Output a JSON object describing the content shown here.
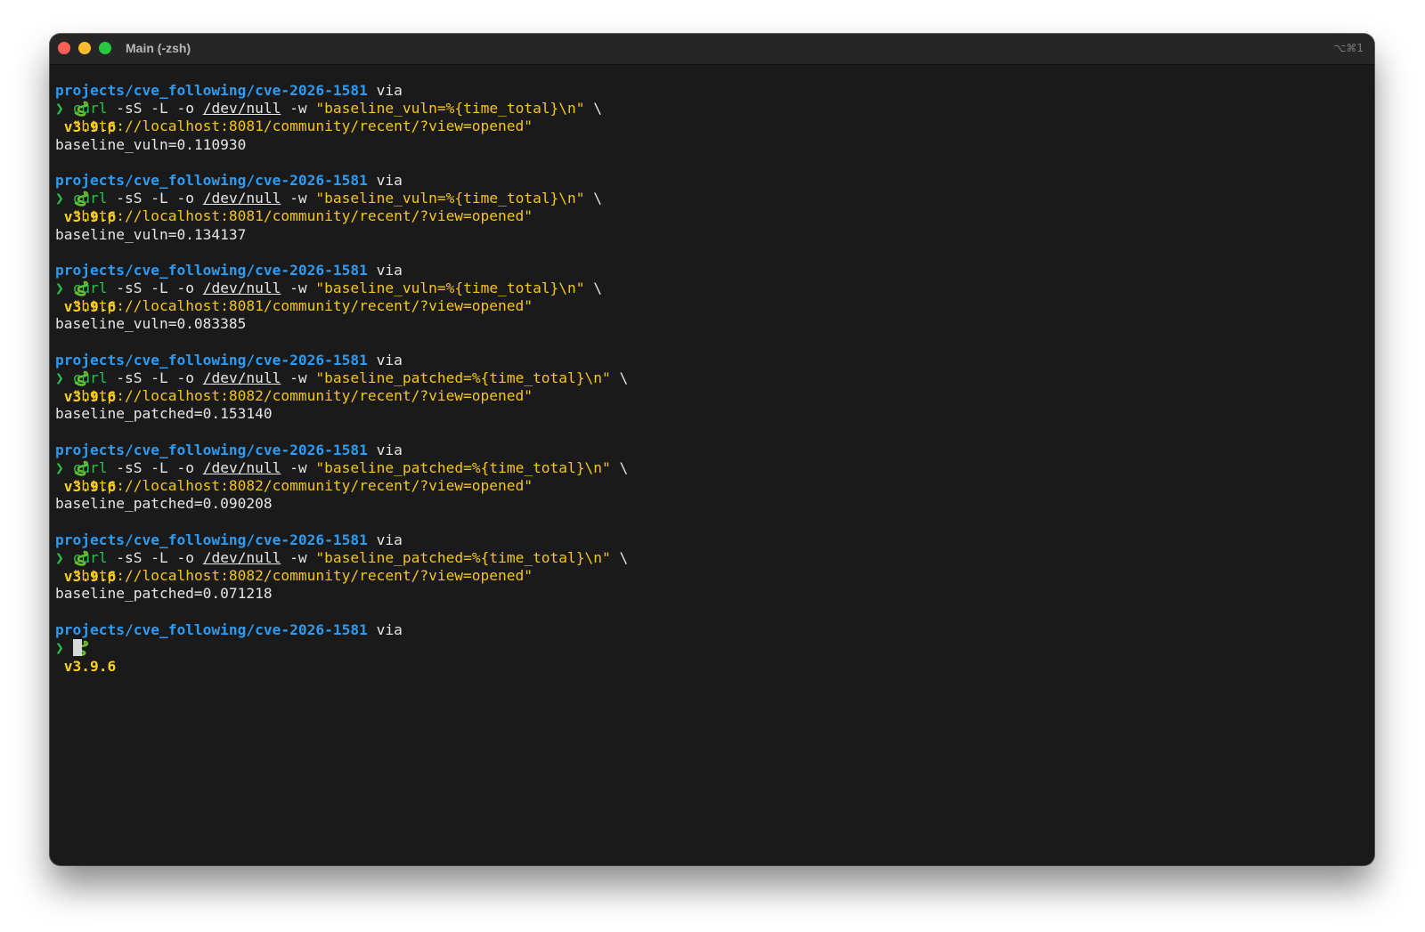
{
  "window": {
    "title": "Main (-zsh)",
    "shortcut": "⌥⌘1"
  },
  "prompt": {
    "path": "projects/cve_following/cve-2026-1581",
    "via": "via",
    "version": "v3.9.6",
    "arrow": "❯"
  },
  "commands": [
    {
      "cmd": "curl",
      "flags": "-sS -L -o",
      "devnull": "/dev/null",
      "wflag": "-w",
      "format": "\"baseline_vuln=%{time_total}\\n\"",
      "cont": "\\",
      "url": "\"http://localhost:8081/community/recent/?view=opened\"",
      "output": "baseline_vuln=0.110930"
    },
    {
      "cmd": "curl",
      "flags": "-sS -L -o",
      "devnull": "/dev/null",
      "wflag": "-w",
      "format": "\"baseline_vuln=%{time_total}\\n\"",
      "cont": "\\",
      "url": "\"http://localhost:8081/community/recent/?view=opened\"",
      "output": "baseline_vuln=0.134137"
    },
    {
      "cmd": "curl",
      "flags": "-sS -L -o",
      "devnull": "/dev/null",
      "wflag": "-w",
      "format": "\"baseline_vuln=%{time_total}\\n\"",
      "cont": "\\",
      "url": "\"http://localhost:8081/community/recent/?view=opened\"",
      "output": "baseline_vuln=0.083385"
    },
    {
      "cmd": "curl",
      "flags": "-sS -L -o",
      "devnull": "/dev/null",
      "wflag": "-w",
      "format": "\"baseline_patched=%{time_total}\\n\"",
      "cont": "\\",
      "url": "\"http://localhost:8082/community/recent/?view=opened\"",
      "output": "baseline_patched=0.153140"
    },
    {
      "cmd": "curl",
      "flags": "-sS -L -o",
      "devnull": "/dev/null",
      "wflag": "-w",
      "format": "\"baseline_patched=%{time_total}\\n\"",
      "cont": "\\",
      "url": "\"http://localhost:8082/community/recent/?view=opened\"",
      "output": "baseline_patched=0.090208"
    },
    {
      "cmd": "curl",
      "flags": "-sS -L -o",
      "devnull": "/dev/null",
      "wflag": "-w",
      "format": "\"baseline_patched=%{time_total}\\n\"",
      "cont": "\\",
      "url": "\"http://localhost:8082/community/recent/?view=opened\"",
      "output": "baseline_patched=0.071218"
    }
  ],
  "icons": {
    "python": "snake-icon"
  },
  "colors": {
    "path": "#2e9bf0",
    "version": "#ffd11a",
    "arrow": "#29c24a",
    "string": "#f5c518",
    "background": "#1a1a1a"
  }
}
